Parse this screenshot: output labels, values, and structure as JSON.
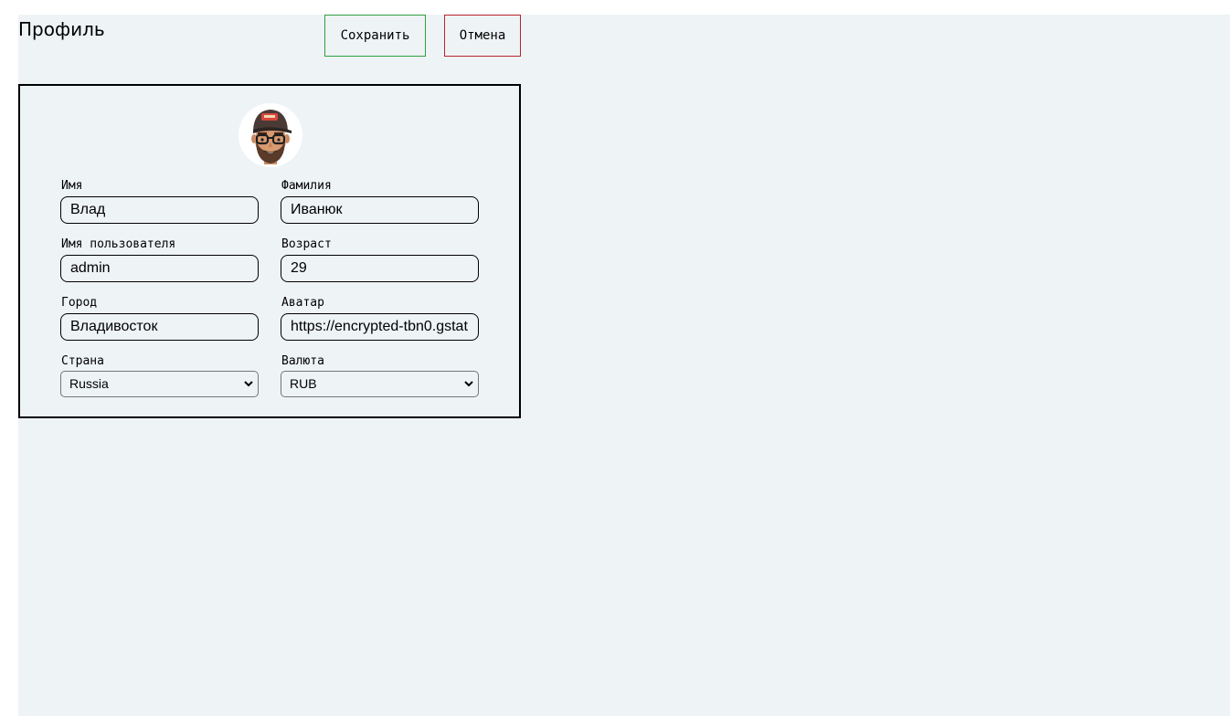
{
  "header": {
    "title": "Профиль",
    "save_label": "Сохранить",
    "cancel_label": "Отмена"
  },
  "colors": {
    "page_background": "#eef3f6",
    "save_border": "#2e9e3f",
    "cancel_border": "#b8232b"
  },
  "profile": {
    "avatar_icon": "avatar-cartoon-man-cap-glasses",
    "first_name": {
      "label": "Имя",
      "value": "Влад"
    },
    "last_name": {
      "label": "Фамилия",
      "value": "Иванюк"
    },
    "username": {
      "label": "Имя пользователя",
      "value": "admin"
    },
    "age": {
      "label": "Возраст",
      "value": "29"
    },
    "city": {
      "label": "Город",
      "value": "Владивосток"
    },
    "avatar_url": {
      "label": "Аватар",
      "value": "https://encrypted-tbn0.gstat"
    },
    "country": {
      "label": "Страна",
      "value": "Russia"
    },
    "currency": {
      "label": "Валюта",
      "value": "RUB"
    }
  }
}
